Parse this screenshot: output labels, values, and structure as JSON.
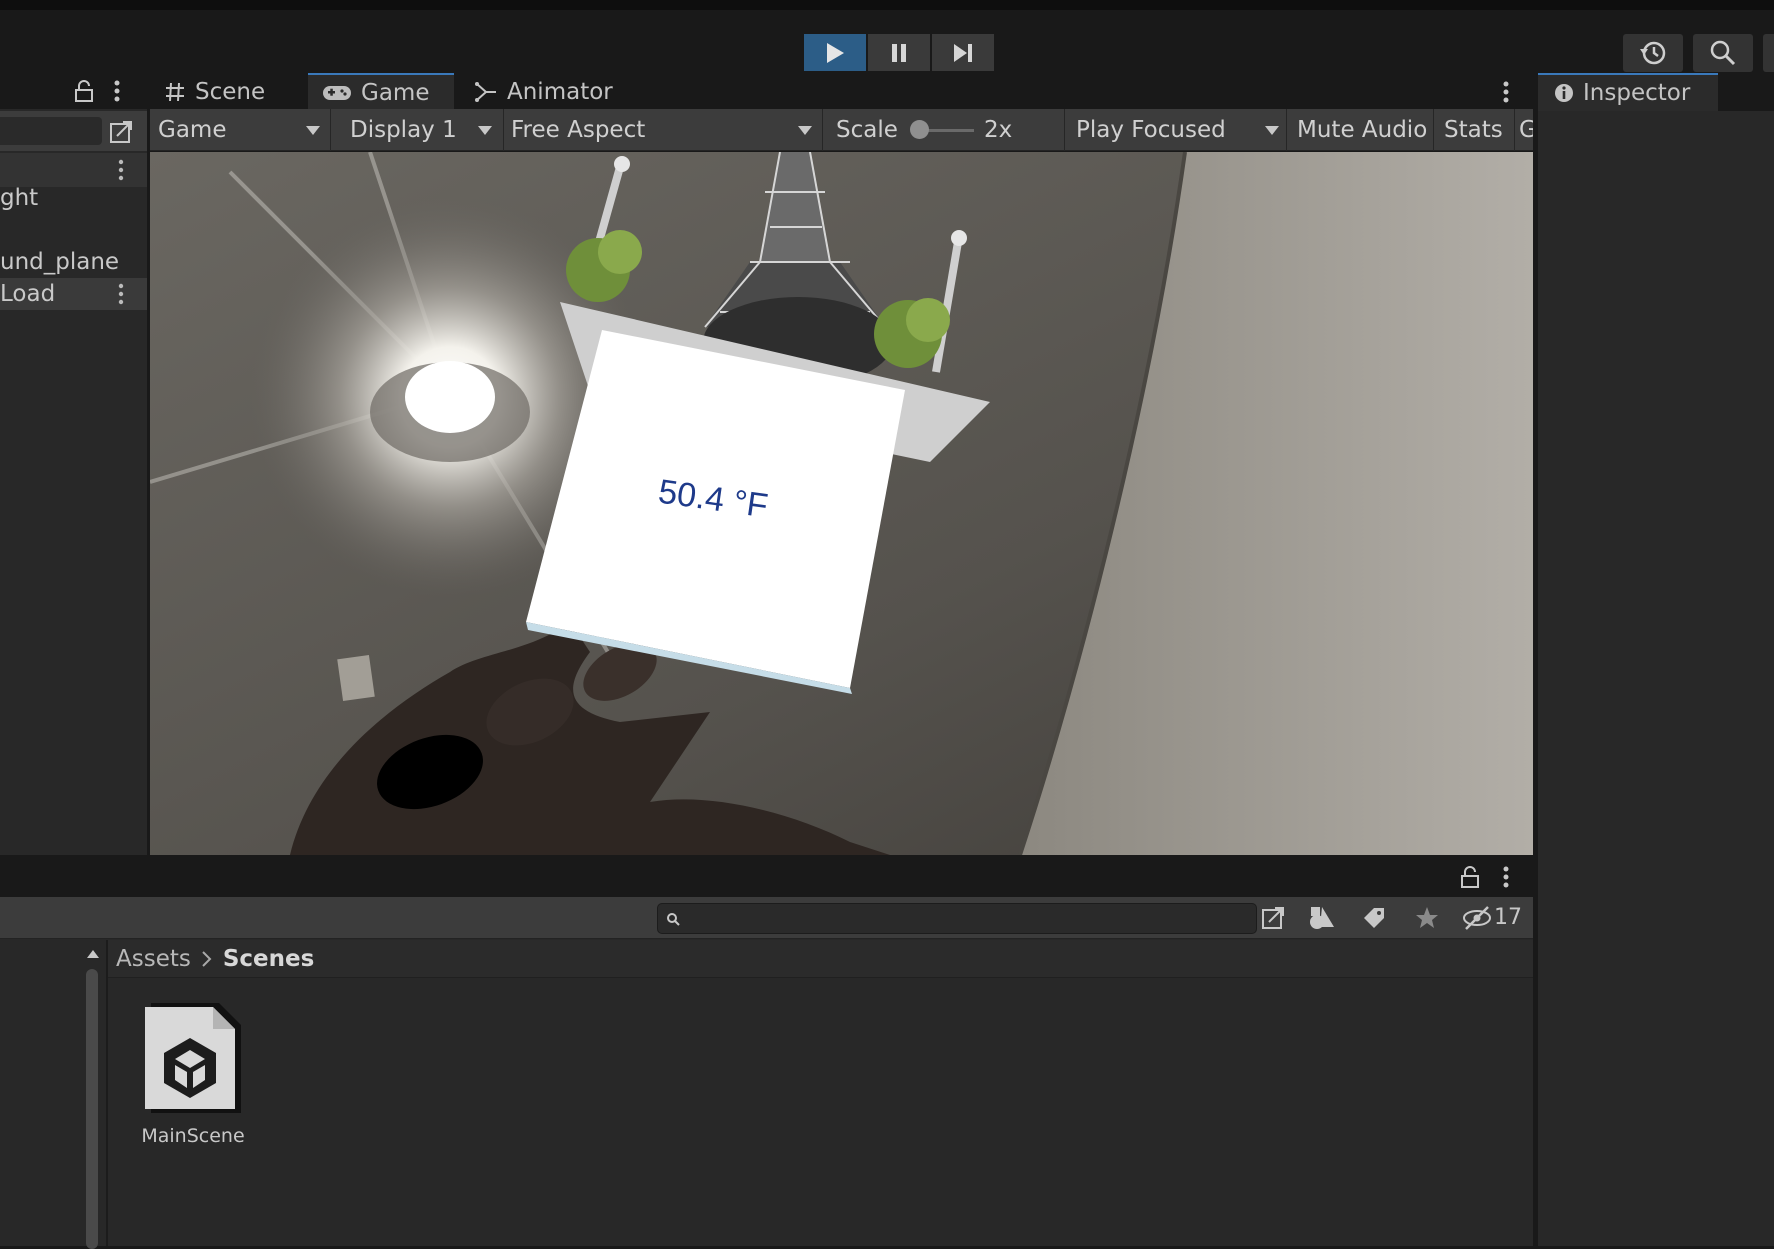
{
  "toolbar": {
    "play_icon": "play-icon",
    "pause_icon": "pause-icon",
    "step_icon": "step-icon",
    "history_icon": "history-icon",
    "search_icon": "search-icon"
  },
  "editor_tabs": [
    {
      "label": "Scene",
      "icon": "hash-icon"
    },
    {
      "label": "Game",
      "icon": "gamepad-icon"
    },
    {
      "label": "Animator",
      "icon": "animator-icon"
    }
  ],
  "inspector": {
    "tab_label": "Inspector",
    "icon": "info-icon"
  },
  "game_toolbar": {
    "mode": "Game",
    "display": "Display 1",
    "aspect": "Free Aspect",
    "scale_label": "Scale",
    "scale_value": "2x",
    "play_mode": "Play Focused",
    "mute_label": "Mute Audio",
    "stats_label": "Stats",
    "gizmos_partial": "G"
  },
  "hierarchy": {
    "items": [
      {
        "label": "ght"
      },
      {
        "label": "und_plane"
      },
      {
        "label": "Load"
      }
    ]
  },
  "game_view": {
    "temperature": "50.4 °F"
  },
  "project": {
    "breadcrumb": [
      "Assets",
      "Scenes"
    ],
    "hidden_count": "17",
    "assets": [
      {
        "name": "MainScene",
        "icon": "unity-scene-icon"
      }
    ]
  },
  "colors": {
    "accent": "#2c5d87",
    "panel": "#282828",
    "toolbar": "#3c3c3c",
    "temperature_text": "#1e3a8a"
  }
}
